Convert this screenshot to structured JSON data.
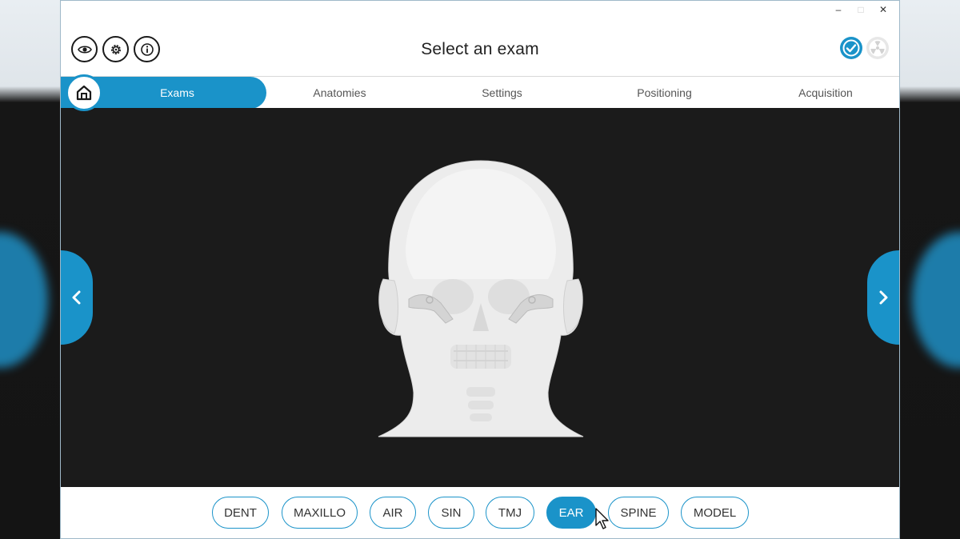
{
  "window": {
    "minimize": "–",
    "maximize": "□",
    "close": "✕"
  },
  "header": {
    "title": "Select an exam",
    "icons": [
      "eye-icon",
      "gear-icon",
      "info-icon"
    ],
    "status_icons": [
      "check-circle-icon",
      "radiation-icon"
    ]
  },
  "tabs": [
    {
      "label": "Exams",
      "active": true
    },
    {
      "label": "Anatomies",
      "active": false
    },
    {
      "label": "Settings",
      "active": false
    },
    {
      "label": "Positioning",
      "active": false
    },
    {
      "label": "Acquisition",
      "active": false
    }
  ],
  "exams": [
    {
      "label": "DENT",
      "active": false
    },
    {
      "label": "MAXILLO",
      "active": false
    },
    {
      "label": "AIR",
      "active": false
    },
    {
      "label": "SIN",
      "active": false
    },
    {
      "label": "TMJ",
      "active": false
    },
    {
      "label": "EAR",
      "active": true
    },
    {
      "label": "SPINE",
      "active": false
    },
    {
      "label": "MODEL",
      "active": false
    }
  ],
  "colors": {
    "accent": "#1a93c9",
    "viewport_bg": "#1b1b1b"
  }
}
